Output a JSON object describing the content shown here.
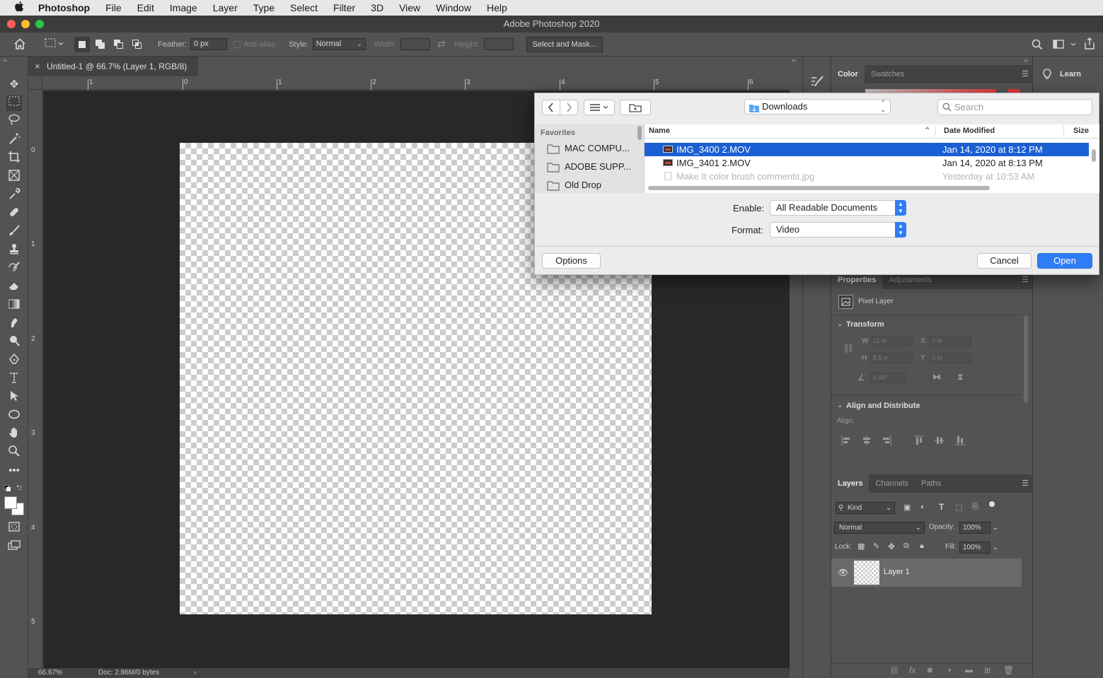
{
  "menubar": {
    "app": "Photoshop",
    "items": [
      "File",
      "Edit",
      "Image",
      "Layer",
      "Type",
      "Select",
      "Filter",
      "3D",
      "View",
      "Window",
      "Help"
    ]
  },
  "window": {
    "title": "Adobe Photoshop 2020"
  },
  "options_bar": {
    "feather_label": "Feather:",
    "feather_value": "0 px",
    "antialias_label": "Anti-alias",
    "style_label": "Style:",
    "style_value": "Normal",
    "width_label": "Width:",
    "height_label": "Height:",
    "select_mask_label": "Select and Mask..."
  },
  "document": {
    "tab_title": "Untitled-1 @ 66.7% (Layer 1, RGB/8)",
    "close_glyph": "×",
    "ruler_top": [
      "1",
      "0",
      "1",
      "2",
      "3",
      "4",
      "5",
      "6"
    ],
    "ruler_left": [
      "0",
      "1",
      "2",
      "3",
      "4",
      "5"
    ],
    "zoom": "66.67%",
    "doc_info": "Doc: 2.86M/0 bytes",
    "status_arrow": "›"
  },
  "panels": {
    "color_tabs": [
      "Color",
      "Swatches"
    ],
    "learn_label": "Learn",
    "properties_tabs": [
      "Properties",
      "Adjustments"
    ],
    "pixel_layer": "Pixel Layer",
    "transform_label": "Transform",
    "w_label": "W",
    "w_value": "11 in",
    "h_label": "H",
    "h_value": "8.5 in",
    "x_label": "X",
    "x_value": "0 in",
    "y_label": "Y",
    "y_value": "0 in",
    "angle_value": "0.00°",
    "align_label": "Align and Distribute",
    "align_sub": "Align:",
    "layers_tabs": [
      "Layers",
      "Channels",
      "Paths"
    ],
    "kind_label": "Kind",
    "blend_mode": "Normal",
    "opacity_label": "Opacity:",
    "opacity_value": "100%",
    "lock_label": "Lock:",
    "fill_label": "Fill:",
    "fill_value": "100%",
    "layer_name": "Layer 1"
  },
  "dialog": {
    "location": "Downloads",
    "search_placeholder": "Search",
    "sidebar_heading": "Favorites",
    "favorites": [
      "MAC COMPU...",
      "ADOBE SUPP...",
      "Old Drop"
    ],
    "columns": {
      "name": "Name",
      "date": "Date Modified",
      "size": "Size"
    },
    "files": [
      {
        "name": "IMG_3400 2.MOV",
        "date": "Jan 14, 2020 at 8:12 PM",
        "selected": true
      },
      {
        "name": "IMG_3401 2.MOV",
        "date": "Jan 14, 2020 at 8:13 PM",
        "selected": false
      },
      {
        "name": "Make It color brush comments.jpg",
        "date": "Yesterday at 10:53 AM",
        "selected": false
      }
    ],
    "enable_label": "Enable:",
    "enable_value": "All Readable Documents",
    "format_label": "Format:",
    "format_value": "Video",
    "options_label": "Options",
    "cancel_label": "Cancel",
    "open_label": "Open"
  },
  "colors": {
    "accent_blue": "#2f7df6",
    "selection_blue": "#1a5fd3",
    "color_bar_red": "#e8373a"
  }
}
